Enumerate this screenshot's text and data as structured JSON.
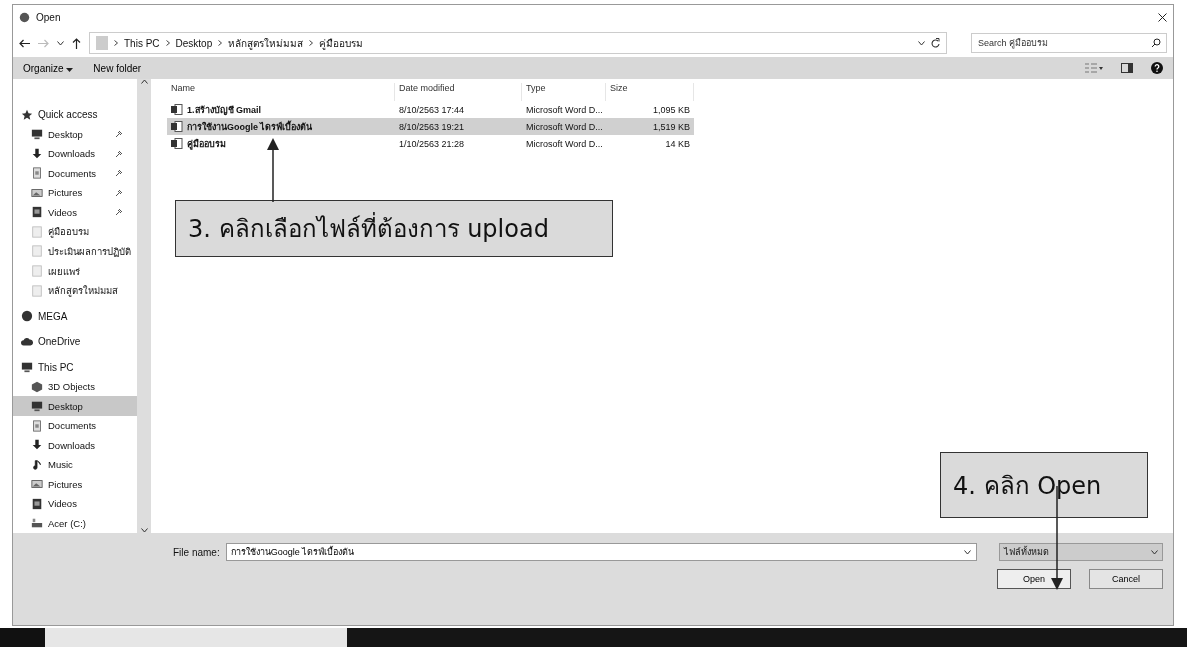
{
  "window": {
    "title": "Open"
  },
  "address": {
    "path": [
      "This PC",
      "Desktop",
      "หลักสูตรใหม่มมส",
      "คู่มืออบรม"
    ],
    "search_placeholder": "Search คู่มืออบรม"
  },
  "toolbar": {
    "organize": "Organize",
    "new_folder": "New folder"
  },
  "sidebar": {
    "items": [
      {
        "label": "Quick access",
        "kind": "quickaccess",
        "pinned": false,
        "selected": false
      },
      {
        "label": "Desktop",
        "kind": "desktop",
        "pinned": true,
        "selected": false
      },
      {
        "label": "Downloads",
        "kind": "downloads",
        "pinned": true,
        "selected": false
      },
      {
        "label": "Documents",
        "kind": "documents",
        "pinned": true,
        "selected": false
      },
      {
        "label": "Pictures",
        "kind": "pictures",
        "pinned": true,
        "selected": false
      },
      {
        "label": "Videos",
        "kind": "videos",
        "pinned": true,
        "selected": false
      },
      {
        "label": "คู่มืออบรม",
        "kind": "folder",
        "pinned": false,
        "selected": false
      },
      {
        "label": "ประเมินผลการปฏิบัติ",
        "kind": "folder",
        "pinned": false,
        "selected": false
      },
      {
        "label": "เผยแพร่",
        "kind": "folder",
        "pinned": false,
        "selected": false
      },
      {
        "label": "หลักสูตรใหม่มมส",
        "kind": "folder",
        "pinned": false,
        "selected": false
      },
      {
        "label": "MEGA",
        "kind": "mega",
        "pinned": false,
        "selected": false
      },
      {
        "label": "OneDrive",
        "kind": "onedrive",
        "pinned": false,
        "selected": false
      },
      {
        "label": "This PC",
        "kind": "thispc",
        "pinned": false,
        "selected": false
      },
      {
        "label": "3D Objects",
        "kind": "objects",
        "pinned": false,
        "selected": false
      },
      {
        "label": "Desktop",
        "kind": "desktop",
        "pinned": false,
        "selected": true
      },
      {
        "label": "Documents",
        "kind": "documents",
        "pinned": false,
        "selected": false
      },
      {
        "label": "Downloads",
        "kind": "downloads",
        "pinned": false,
        "selected": false
      },
      {
        "label": "Music",
        "kind": "music",
        "pinned": false,
        "selected": false
      },
      {
        "label": "Pictures",
        "kind": "pictures",
        "pinned": false,
        "selected": false
      },
      {
        "label": "Videos",
        "kind": "videos",
        "pinned": false,
        "selected": false
      },
      {
        "label": "Acer (C:)",
        "kind": "drive",
        "pinned": false,
        "selected": false
      }
    ]
  },
  "table": {
    "columns": [
      "Name",
      "Date modified",
      "Type",
      "Size"
    ],
    "rows": [
      {
        "name": "1.สร้างบัญชี Gmail",
        "date": "8/10/2563 17:44",
        "type": "Microsoft Word D...",
        "size": "1,095 KB",
        "selected": false
      },
      {
        "name": "การใช้งานGoogle ไดรฟ์เบื้องต้น",
        "date": "8/10/2563 19:21",
        "type": "Microsoft Word D...",
        "size": "1,519 KB",
        "selected": true
      },
      {
        "name": "คู่มืออบรม",
        "date": "1/10/2563 21:28",
        "type": "Microsoft Word D...",
        "size": "14 KB",
        "selected": false
      }
    ]
  },
  "footer": {
    "file_name_label": "File name:",
    "file_name": "การใช้งานGoogle ไดรฟ์เบื้องต้น",
    "file_type": "ไฟล์ทั้งหมด",
    "buttons": [
      "Open",
      "Cancel"
    ]
  },
  "callouts": [
    {
      "text": "3. คลิกเลือกไฟล์ที่ต้องการ upload"
    },
    {
      "text": "4. คลิก Open"
    }
  ]
}
